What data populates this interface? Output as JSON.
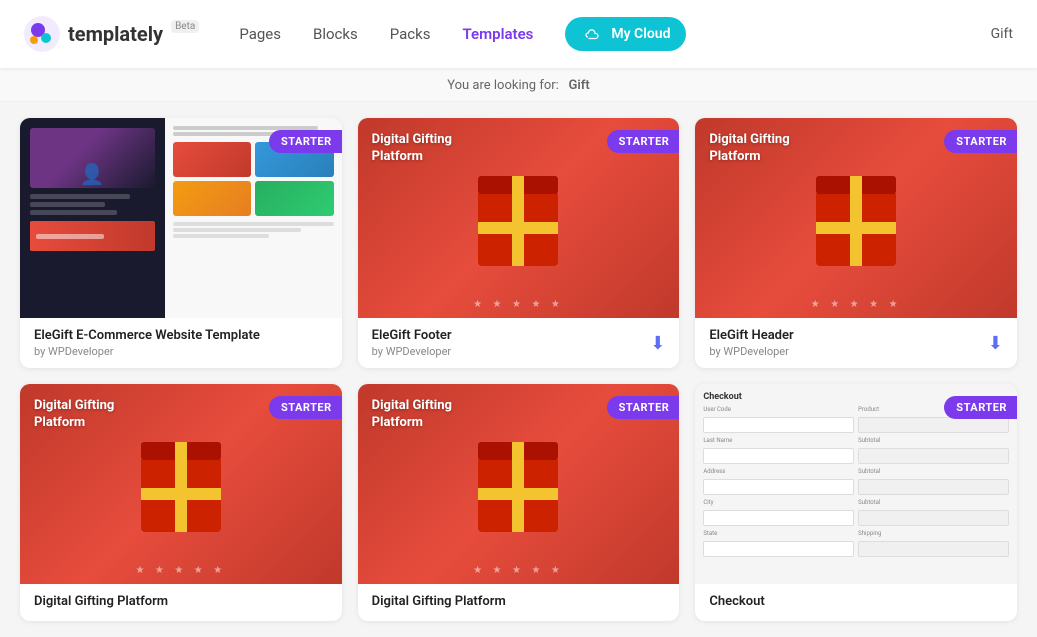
{
  "header": {
    "logo_text": "templately",
    "beta_label": "Beta",
    "nav_items": [
      {
        "label": "Pages",
        "active": false
      },
      {
        "label": "Blocks",
        "active": false
      },
      {
        "label": "Packs",
        "active": false
      },
      {
        "label": "Templates",
        "active": true
      },
      {
        "label": "My Cloud",
        "active": false
      }
    ],
    "my_cloud_label": "My Cloud",
    "search_value": "Gift"
  },
  "search_bar": {
    "prefix": "You are looking for:",
    "keyword": "Gift"
  },
  "cards": [
    {
      "id": "elegift-ecommerce",
      "title": "EleGift E-Commerce Website Template",
      "author": "by WPDeveloper",
      "badge": "STARTER",
      "thumb_type": "elegift_ecommerce",
      "has_download": false
    },
    {
      "id": "elegift-footer",
      "title": "EleGift Footer",
      "author": "by WPDeveloper",
      "badge": "STARTER",
      "thumb_type": "gift_box",
      "has_download": true
    },
    {
      "id": "elegift-header",
      "title": "EleGift Header",
      "author": "by WPDeveloper",
      "badge": "STARTER",
      "thumb_type": "gift_box",
      "has_download": true
    },
    {
      "id": "digital-gifting-1",
      "title": "Digital Gifting Platform",
      "author": "",
      "badge": "STARTER",
      "thumb_type": "gift_box",
      "has_download": false
    },
    {
      "id": "digital-gifting-2",
      "title": "Digital Gifting Platform",
      "author": "",
      "badge": "STARTER",
      "thumb_type": "gift_box",
      "has_download": false
    },
    {
      "id": "checkout",
      "title": "Checkout",
      "author": "",
      "badge": "STARTER",
      "thumb_type": "checkout",
      "has_download": false
    }
  ],
  "starter_badge_label": "STARTER",
  "download_icon": "⬇"
}
